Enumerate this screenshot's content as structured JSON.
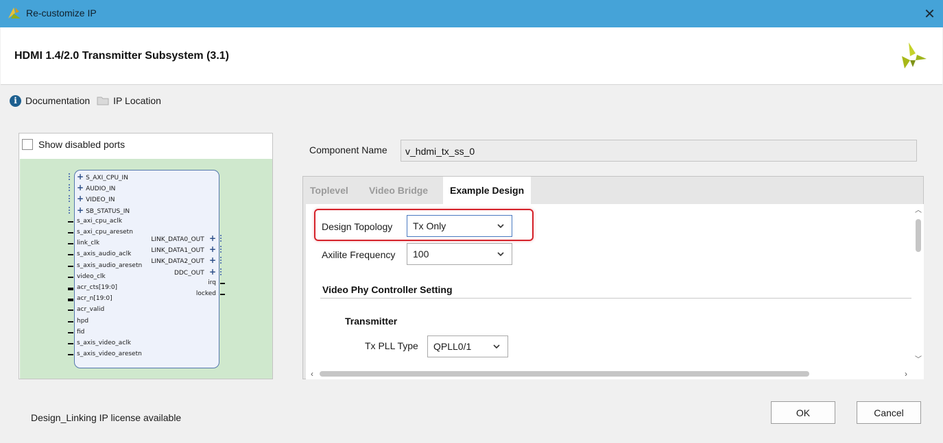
{
  "window": {
    "title": "Re-customize IP",
    "close_label": "✕"
  },
  "header": {
    "title": "HDMI 1.4/2.0 Transmitter Subsystem (3.1)"
  },
  "links": {
    "documentation": "Documentation",
    "ip_location": "IP Location"
  },
  "left_panel": {
    "show_disabled_ports": "Show disabled ports",
    "show_disabled_ports_checked": false,
    "left_ports": [
      {
        "name": "S_AXI_CPU_IN",
        "kind": "bus"
      },
      {
        "name": "AUDIO_IN",
        "kind": "bus"
      },
      {
        "name": "VIDEO_IN",
        "kind": "bus"
      },
      {
        "name": "SB_STATUS_IN",
        "kind": "bus"
      },
      {
        "name": "s_axi_cpu_aclk",
        "kind": "pin"
      },
      {
        "name": "s_axi_cpu_aresetn",
        "kind": "reset"
      },
      {
        "name": "link_clk",
        "kind": "pin"
      },
      {
        "name": "s_axis_audio_aclk",
        "kind": "pin"
      },
      {
        "name": "s_axis_audio_aresetn",
        "kind": "reset"
      },
      {
        "name": "video_clk",
        "kind": "pin"
      },
      {
        "name": "acr_cts[19:0]",
        "kind": "vector"
      },
      {
        "name": "acr_n[19:0]",
        "kind": "vector"
      },
      {
        "name": "acr_valid",
        "kind": "pin"
      },
      {
        "name": "hpd",
        "kind": "pin"
      },
      {
        "name": "fid",
        "kind": "pin"
      },
      {
        "name": "s_axis_video_aclk",
        "kind": "pin"
      },
      {
        "name": "s_axis_video_aresetn",
        "kind": "reset"
      }
    ],
    "right_ports": [
      {
        "name": "LINK_DATA0_OUT",
        "kind": "bus"
      },
      {
        "name": "LINK_DATA1_OUT",
        "kind": "bus"
      },
      {
        "name": "LINK_DATA2_OUT",
        "kind": "bus"
      },
      {
        "name": "DDC_OUT",
        "kind": "bus"
      },
      {
        "name": "irq",
        "kind": "pin"
      },
      {
        "name": "locked",
        "kind": "pin"
      }
    ]
  },
  "component": {
    "label": "Component Name",
    "value": "v_hdmi_tx_ss_0"
  },
  "tabs": [
    {
      "label": "Toplevel",
      "active": false
    },
    {
      "label": "Video Bridge",
      "active": false
    },
    {
      "label": "Example Design",
      "active": true
    }
  ],
  "example_design": {
    "design_topology": {
      "label": "Design Topology",
      "value": "Tx Only"
    },
    "axilite_frequency": {
      "label": "Axilite Frequency",
      "value": "100"
    },
    "video_phy_section": "Video Phy Controller Setting",
    "transmitter_section": "Transmitter",
    "tx_pll_type": {
      "label": "Tx PLL Type",
      "value": "QPLL0/1"
    }
  },
  "footer": {
    "license": "Design_Linking IP license available",
    "ok_label": "OK",
    "cancel_label": "Cancel"
  },
  "colors": {
    "titlebar": "#45a3d8",
    "highlight": "#d5222a",
    "diagram_bg": "#cfe8cd",
    "logo": "#a8b818"
  }
}
